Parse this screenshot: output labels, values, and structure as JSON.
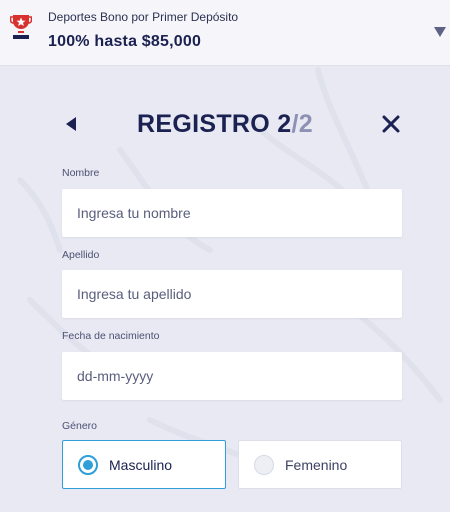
{
  "promo": {
    "subtitle": "Deportes Bono por Primer Depósito",
    "title": "100% hasta $85,000",
    "icon": "trophy-star-icon",
    "toggle_icon": "chevron-down-icon"
  },
  "header": {
    "title_main": "REGISTRO 2",
    "title_sep": "/",
    "title_total": "2",
    "back_icon": "back-arrow-icon",
    "close_icon": "close-icon"
  },
  "form": {
    "nombre": {
      "label": "Nombre",
      "placeholder": "Ingresa tu nombre",
      "value": ""
    },
    "apellido": {
      "label": "Apellido",
      "placeholder": "Ingresa tu apellido",
      "value": ""
    },
    "fecha": {
      "label": "Fecha de nacimiento",
      "placeholder": "dd-mm-yyyy",
      "value": ""
    },
    "genero": {
      "label": "Género",
      "options": [
        {
          "label": "Masculino",
          "selected": true
        },
        {
          "label": "Femenino",
          "selected": false
        }
      ]
    }
  },
  "colors": {
    "primary": "#1b2150",
    "accent": "#2e9fd8",
    "brand_red": "#d8322e",
    "background": "#e8e9f2"
  }
}
